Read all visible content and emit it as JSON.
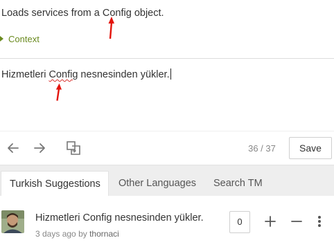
{
  "source": {
    "text_before": "Loads services from a ",
    "text_highlight": "Config",
    "text_after": " object.",
    "context_label": "Context"
  },
  "editor": {
    "text_before": "Hizmetleri ",
    "text_highlight": "Config",
    "text_after": " nesnesinden yükler."
  },
  "toolbar": {
    "icons": [
      "arrow-left-icon",
      "arrow-right-icon",
      "copy-source-icon"
    ],
    "counter": "36 / 37",
    "save_label": "Save"
  },
  "tabs": [
    {
      "label": "Turkish Suggestions",
      "active": true
    },
    {
      "label": "Other Languages",
      "active": false
    },
    {
      "label": "Search TM",
      "active": false
    }
  ],
  "suggestion": {
    "text": "Hizmetleri Config nesnesinden yükler.",
    "time": "3 days ago",
    "by": "by",
    "user": "thornaci",
    "votes": "0",
    "icons": [
      "plus-icon",
      "minus-icon",
      "more-vertical-icon"
    ]
  },
  "colors": {
    "context_green": "#6a8a1f",
    "spell_error": "#d9302c",
    "annotation_arrow": "#e3140c",
    "tabs_bg": "#eeeeee"
  }
}
